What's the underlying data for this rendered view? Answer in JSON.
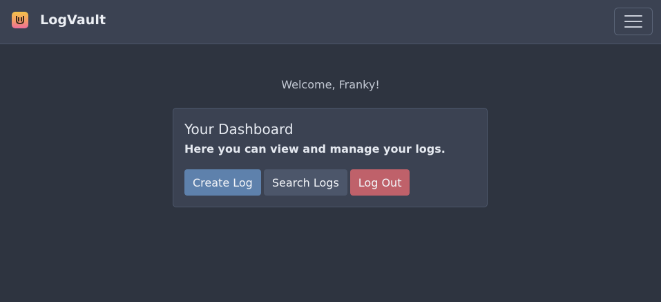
{
  "navbar": {
    "brand": "LogVault",
    "logo_icon": "logvault-logo-icon",
    "menu_icon": "hamburger-menu-icon"
  },
  "main": {
    "welcome": "Welcome, Franky!",
    "card": {
      "title": "Your Dashboard",
      "text": "Here you can view and manage your logs.",
      "buttons": {
        "create": "Create Log",
        "search": "Search Logs",
        "logout": "Log Out"
      }
    }
  },
  "colors": {
    "background": "#2e3440",
    "navbar": "#3b4252",
    "primary": "#5e81ac",
    "secondary": "#4c566a",
    "danger": "#bf616a"
  }
}
